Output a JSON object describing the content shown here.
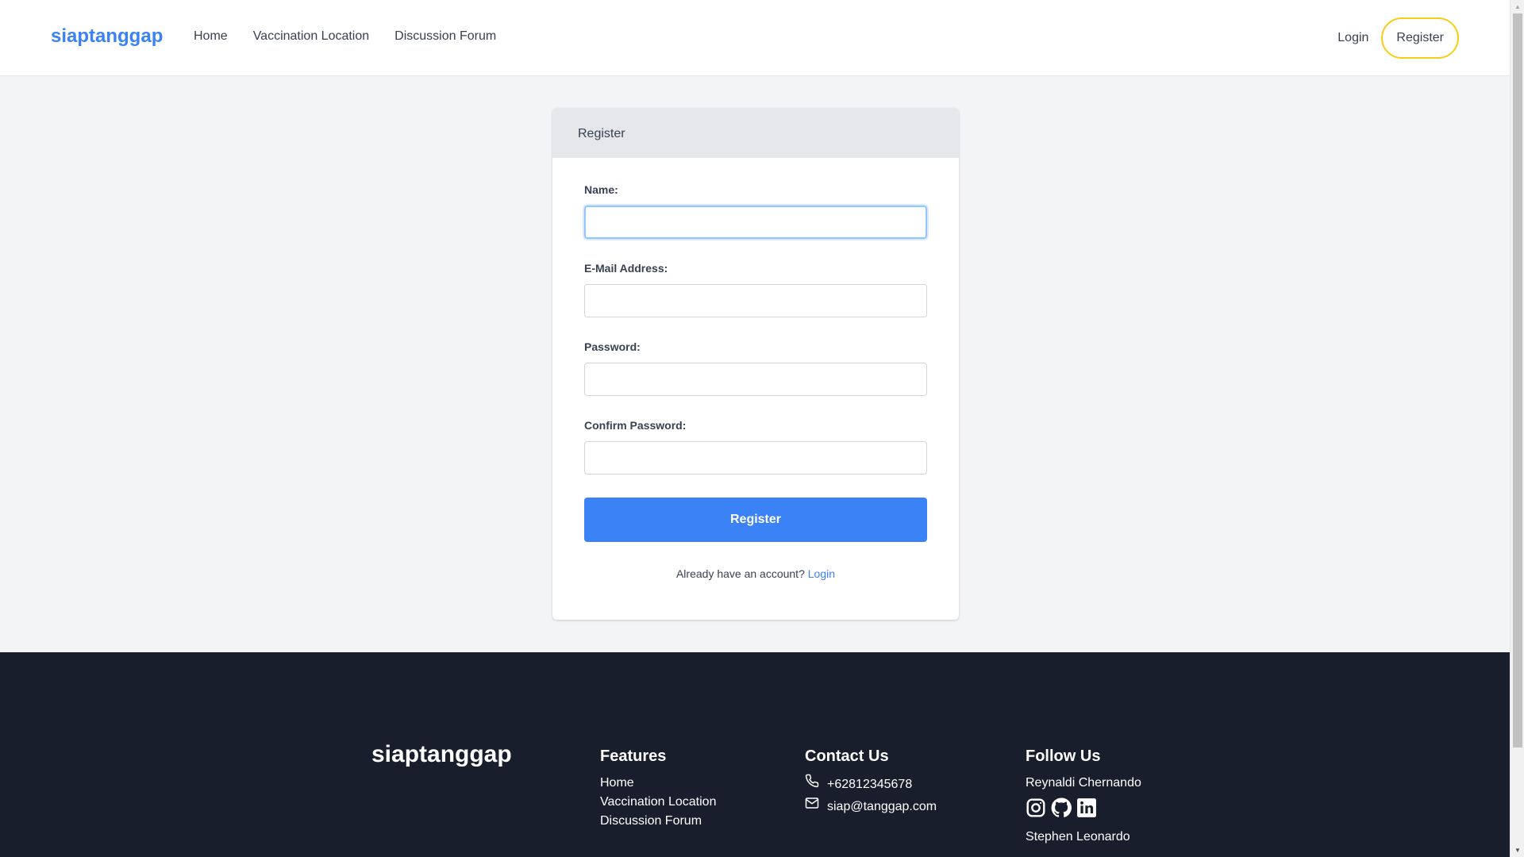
{
  "header": {
    "brand": "siaptanggap",
    "nav": [
      "Home",
      "Vaccination Location",
      "Discussion Forum"
    ],
    "login": "Login",
    "register": "Register"
  },
  "form": {
    "title": "Register",
    "fields": [
      {
        "label": "Name:",
        "value": ""
      },
      {
        "label": "E-Mail Address:",
        "value": ""
      },
      {
        "label": "Password:",
        "value": ""
      },
      {
        "label": "Confirm Password:",
        "value": ""
      }
    ],
    "submit": "Register",
    "already_text": "Already have an account?",
    "login_link": "Login"
  },
  "footer": {
    "brand": "siaptanggap",
    "features_title": "Features",
    "features": [
      "Home",
      "Vaccination Location",
      "Discussion Forum"
    ],
    "contact_title": "Contact Us",
    "phone": "+62812345678",
    "email": "siap@tanggap.com",
    "follow_title": "Follow Us",
    "people": [
      "Reynaldi Chernando",
      "Stephen Leonardo"
    ]
  },
  "colors": {
    "accent": "#3b82f6",
    "register_border": "#facc15",
    "footer_bg": "#181e2b",
    "page_bg": "#f3f4f6"
  },
  "icons": [
    "phone-icon",
    "mail-icon",
    "instagram-icon",
    "github-icon",
    "linkedin-icon"
  ]
}
